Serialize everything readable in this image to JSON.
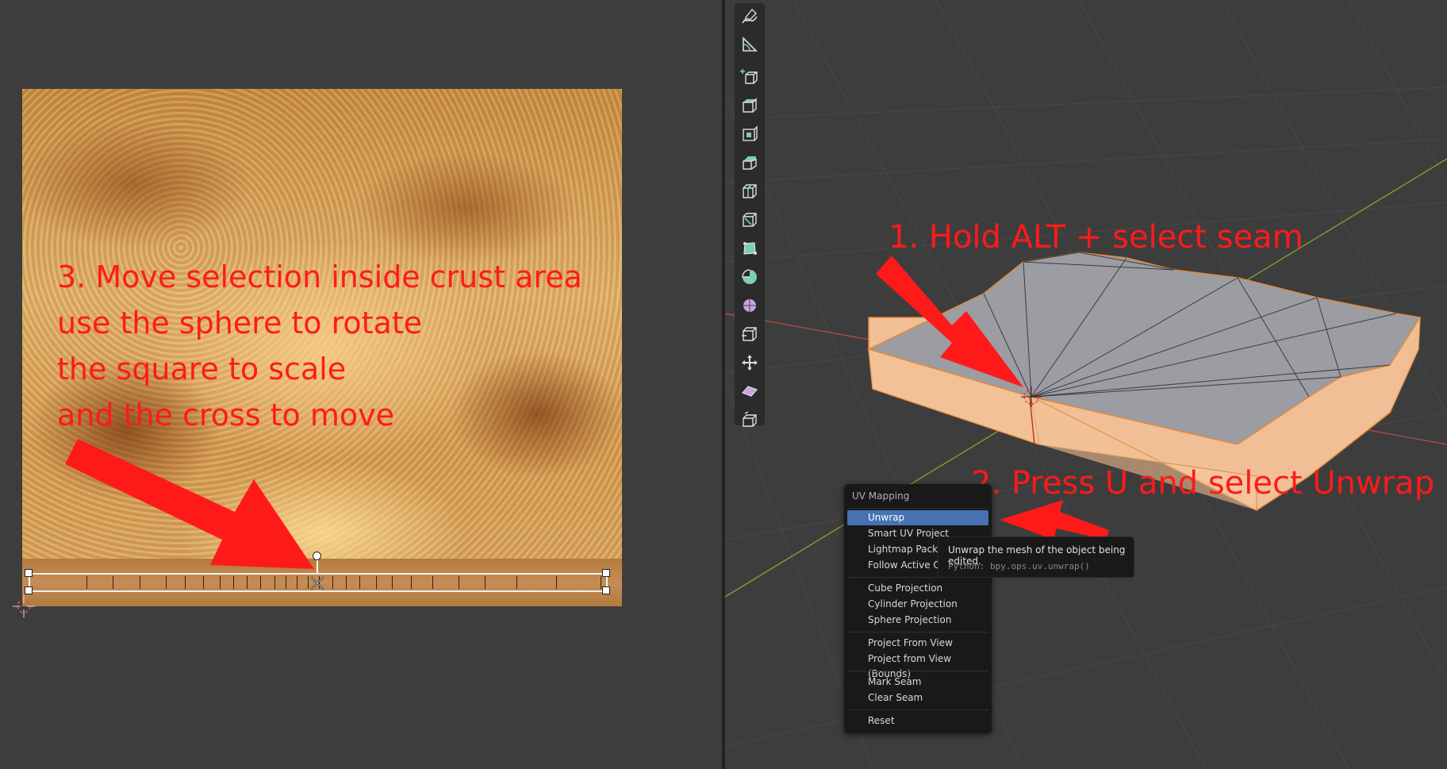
{
  "annotations": {
    "step1": "1. Hold ALT + select seam",
    "step2": "2. Press U and select Unwrap",
    "step3": [
      "3. Move selection inside crust area",
      "use the sphere to rotate",
      "the square to scale",
      "and the cross to move"
    ]
  },
  "uv_menu": {
    "title": "UV Mapping",
    "items": [
      "Unwrap",
      "Smart UV Project",
      "Lightmap Pack",
      "Follow Active Quads",
      "Cube Projection",
      "Cylinder Projection",
      "Sphere Projection",
      "Project From View",
      "Project from View (Bounds)",
      "Mark Seam",
      "Clear Seam",
      "Reset"
    ],
    "active_item": "Unwrap"
  },
  "tooltip": {
    "description": "Unwrap the mesh of the object being edited.",
    "python": "Python: bpy.ops.uv.unwrap()"
  },
  "toolbar_icons": [
    "annotate-icon",
    "measure-icon",
    "add-cube-icon",
    "extrude-region-icon",
    "inset-faces-icon",
    "bevel-icon",
    "loop-cut-icon",
    "knife-icon",
    "poly-build-icon",
    "spin-icon",
    "smooth-icon",
    "edge-slide-icon",
    "shrink-fatten-icon",
    "shear-icon",
    "rip-region-icon"
  ],
  "colors": {
    "annotation": "#ff1a1a",
    "menu_highlight": "#4772b3",
    "mesh_side": "#f2c29a",
    "mesh_top": "#9a9aa0",
    "x_axis": "#c84a4a",
    "y_axis": "#8fb23a"
  }
}
